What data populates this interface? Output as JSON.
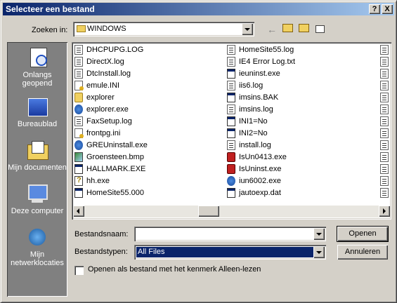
{
  "window": {
    "title": "Selecteer een bestand",
    "help_btn": "?",
    "close_btn": "X"
  },
  "lookin": {
    "label": "Zoeken in:",
    "value": "WINDOWS"
  },
  "places": [
    {
      "label": "Onlangs geopend",
      "icon": "recent-icon"
    },
    {
      "label": "Bureaublad",
      "icon": "desktop-icon"
    },
    {
      "label": "Mijn documenten",
      "icon": "my-documents-icon"
    },
    {
      "label": "Deze computer",
      "icon": "my-computer-icon"
    },
    {
      "label": "Mijn netwerklocaties",
      "icon": "network-places-icon"
    }
  ],
  "files_col1": [
    {
      "name": "DHCPUPG.LOG",
      "icon": "doc"
    },
    {
      "name": "DirectX.log",
      "icon": "doc"
    },
    {
      "name": "DtcInstall.log",
      "icon": "doc"
    },
    {
      "name": "emule.INI",
      "icon": "ini"
    },
    {
      "name": "explorer",
      "icon": "fold"
    },
    {
      "name": "explorer.exe",
      "icon": "glob"
    },
    {
      "name": "FaxSetup.log",
      "icon": "doc"
    },
    {
      "name": "frontpg.ini",
      "icon": "ini"
    },
    {
      "name": "GREUninstall.exe",
      "icon": "glob"
    },
    {
      "name": "Groensteen.bmp",
      "icon": "bmp"
    },
    {
      "name": "HALLMARK.EXE",
      "icon": "exe"
    },
    {
      "name": "hh.exe",
      "icon": "hlp"
    },
    {
      "name": "HomeSite55.000",
      "icon": "exe"
    }
  ],
  "files_col2": [
    {
      "name": "HomeSite55.log",
      "icon": "doc"
    },
    {
      "name": "IE4 Error Log.txt",
      "icon": "doc"
    },
    {
      "name": "ieuninst.exe",
      "icon": "exe"
    },
    {
      "name": "iis6.log",
      "icon": "doc"
    },
    {
      "name": "imsins.BAK",
      "icon": "exe"
    },
    {
      "name": "imsins.log",
      "icon": "doc"
    },
    {
      "name": "INI1=No",
      "icon": "exe"
    },
    {
      "name": "INI2=No",
      "icon": "exe"
    },
    {
      "name": "install.log",
      "icon": "doc"
    },
    {
      "name": "IsUn0413.exe",
      "icon": "inst"
    },
    {
      "name": "IsUninst.exe",
      "icon": "inst"
    },
    {
      "name": "iun6002.exe",
      "icon": "glob"
    },
    {
      "name": "jautoexp.dat",
      "icon": "exe"
    }
  ],
  "filename": {
    "label": "Bestandsnaam:",
    "value": ""
  },
  "filetype": {
    "label": "Bestandstypen:",
    "value": "All Files"
  },
  "buttons": {
    "open": "Openen",
    "cancel": "Annuleren"
  },
  "readonly": {
    "label": "Openen als bestand met het kenmerk Alleen-lezen",
    "checked": false
  }
}
